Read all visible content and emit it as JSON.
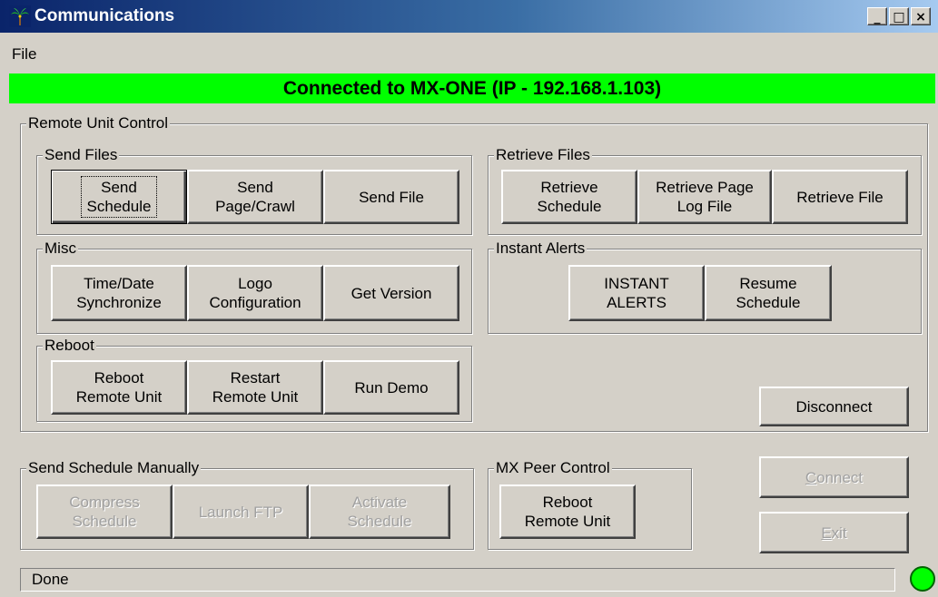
{
  "window": {
    "title": "Communications",
    "controls": {
      "minimize": "_",
      "maximize": "□",
      "close": "×"
    }
  },
  "menu": {
    "file": "File"
  },
  "connection_status": "Connected to MX-ONE (IP - 192.168.1.103)",
  "remote_unit_control": {
    "label": "Remote Unit Control",
    "send_files": {
      "label": "Send Files",
      "send_schedule": "Send\nSchedule",
      "send_page_crawl": "Send\nPage/Crawl",
      "send_file": "Send File"
    },
    "retrieve_files": {
      "label": "Retrieve Files",
      "retrieve_schedule": "Retrieve\nSchedule",
      "retrieve_page_log": "Retrieve Page\nLog File",
      "retrieve_file": "Retrieve File"
    },
    "misc": {
      "label": "Misc",
      "time_date_sync": "Time/Date\nSynchronize",
      "logo_config": "Logo\nConfiguration",
      "get_version": "Get Version"
    },
    "instant_alerts": {
      "label": "Instant Alerts",
      "instant_alerts": "INSTANT\nALERTS",
      "resume_schedule": "Resume\nSchedule"
    },
    "reboot": {
      "label": "Reboot",
      "reboot_remote": "Reboot\nRemote Unit",
      "restart_remote": "Restart\nRemote Unit",
      "run_demo": "Run Demo"
    },
    "disconnect": "Disconnect"
  },
  "send_schedule_manually": {
    "label": "Send Schedule Manually",
    "compress_schedule": "Compress\nSchedule",
    "launch_ftp": "Launch FTP",
    "activate_schedule": "Activate\nSchedule"
  },
  "mx_peer_control": {
    "label": "MX Peer Control",
    "reboot_remote": "Reboot\nRemote Unit"
  },
  "connect": {
    "first": "C",
    "rest": "onnect"
  },
  "exit": {
    "first": "E",
    "rest": "xit"
  },
  "status_text": "Done",
  "colors": {
    "connected": "#00ff00",
    "disabled_text": "#a0a0a0"
  }
}
